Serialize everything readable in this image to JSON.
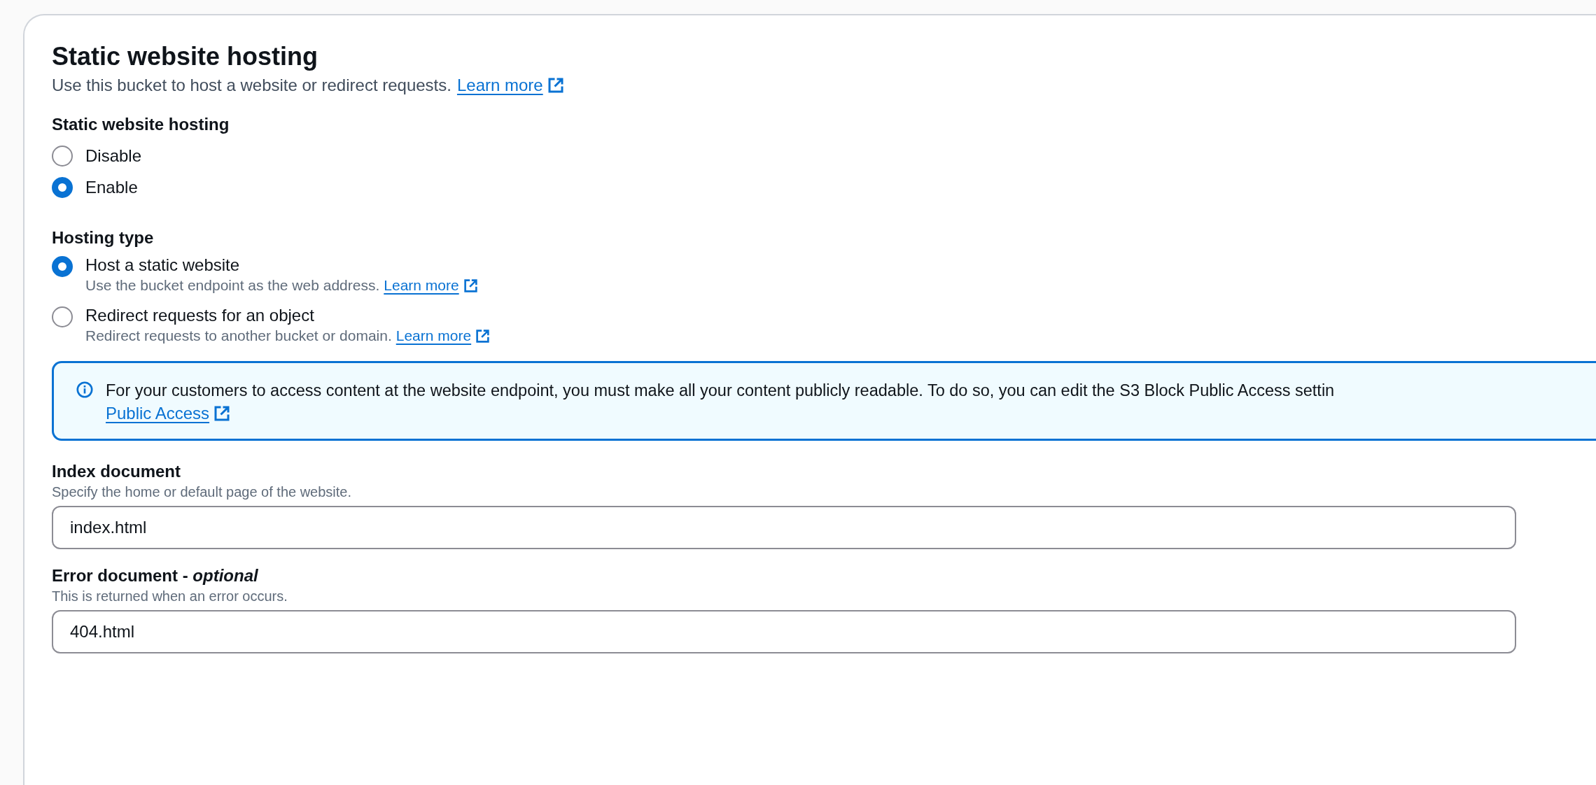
{
  "panel": {
    "title": "Static website hosting",
    "description": "Use this bucket to host a website or redirect requests.",
    "link": "Learn more"
  },
  "hosting": {
    "label": "Static website hosting",
    "options": [
      {
        "label": "Disable",
        "selected": false
      },
      {
        "label": "Enable",
        "selected": true
      }
    ]
  },
  "hosting_type": {
    "label": "Hosting type",
    "options": [
      {
        "label": "Host a static website",
        "description": "Use the bucket endpoint as the web address.",
        "link": "Learn more",
        "selected": true
      },
      {
        "label": "Redirect requests for an object",
        "description": "Redirect requests to another bucket or domain.",
        "link": "Learn more",
        "selected": false
      }
    ]
  },
  "alert": {
    "text": "For your customers to access content at the website endpoint, you must make all your content publicly readable. To do so, you can edit the S3 Block Public Access settin",
    "link": "Public Access"
  },
  "fields": [
    {
      "label": "Index document",
      "hint": "Specify the home or default page of the website.",
      "value": "index.html"
    },
    {
      "label": "Error document - *optional*",
      "hint": "This is returned when an error occurs.",
      "value": "404.html"
    }
  ]
}
